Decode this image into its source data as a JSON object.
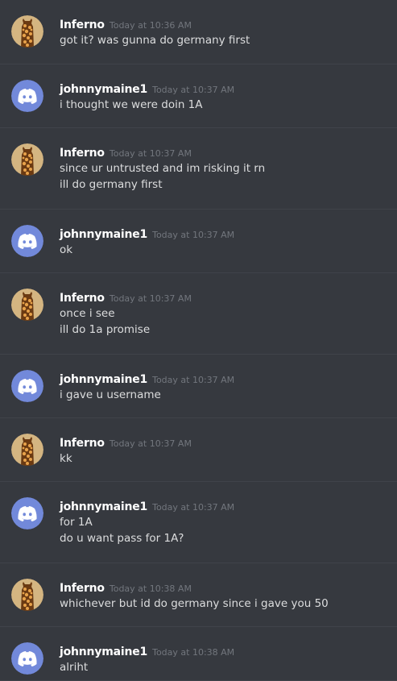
{
  "channel": {
    "messages": [
      {
        "author": "Inferno",
        "avatar": "giraffe-avatar-icon",
        "timestamp": "Today at 10:36 AM",
        "lines": [
          "got it? was gunna do germany first"
        ]
      },
      {
        "author": "johnnymaine1",
        "avatar": "discord-logo-avatar-icon",
        "timestamp": "Today at 10:37 AM",
        "lines": [
          "i thought we were doin 1A"
        ]
      },
      {
        "author": "Inferno",
        "avatar": "giraffe-avatar-icon",
        "timestamp": "Today at 10:37 AM",
        "lines": [
          "since ur untrusted and im risking it rn",
          "ill do germany first"
        ]
      },
      {
        "author": "johnnymaine1",
        "avatar": "discord-logo-avatar-icon",
        "timestamp": "Today at 10:37 AM",
        "lines": [
          "ok"
        ]
      },
      {
        "author": "Inferno",
        "avatar": "giraffe-avatar-icon",
        "timestamp": "Today at 10:37 AM",
        "lines": [
          "once i see",
          "ill do 1a promise"
        ]
      },
      {
        "author": "johnnymaine1",
        "avatar": "discord-logo-avatar-icon",
        "timestamp": "Today at 10:37 AM",
        "lines": [
          "i gave u username"
        ]
      },
      {
        "author": "Inferno",
        "avatar": "giraffe-avatar-icon",
        "timestamp": "Today at 10:37 AM",
        "lines": [
          "kk"
        ]
      },
      {
        "author": "johnnymaine1",
        "avatar": "discord-logo-avatar-icon",
        "timestamp": "Today at 10:37 AM",
        "lines": [
          "for 1A",
          "do u want pass for 1A?"
        ]
      },
      {
        "author": "Inferno",
        "avatar": "giraffe-avatar-icon",
        "timestamp": "Today at 10:38 AM",
        "lines": [
          "whichever but id do germany since i gave you 50"
        ]
      },
      {
        "author": "johnnymaine1",
        "avatar": "discord-logo-avatar-icon",
        "timestamp": "Today at 10:38 AM",
        "lines": [
          "alriht"
        ]
      }
    ]
  },
  "colors": {
    "background": "#36393f",
    "author": "#ffffff",
    "timestamp": "#72767d",
    "text": "#dcddde",
    "blurple": "#7289da",
    "divider": "#40434a"
  }
}
